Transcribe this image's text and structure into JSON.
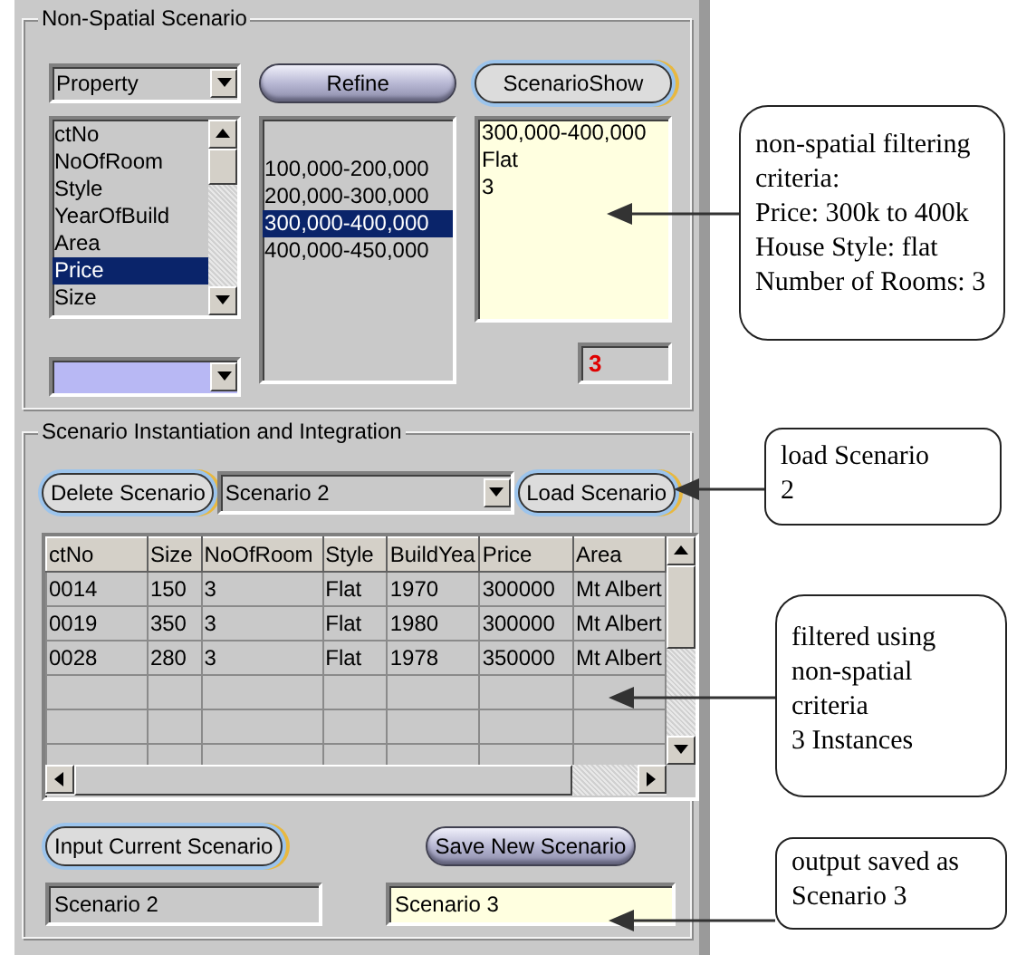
{
  "non_spatial_scenario": {
    "title": "Non-Spatial Scenario",
    "property_dropdown": {
      "value": "Property"
    },
    "refine_button": {
      "label": "Refine",
      "kind": "glossy"
    },
    "scenario_show_button": {
      "label": "ScenarioShow",
      "kind": "ring"
    },
    "fields_list": {
      "items": [
        {
          "label": "ctNo",
          "selected": false
        },
        {
          "label": "NoOfRoom",
          "selected": false
        },
        {
          "label": "Style",
          "selected": false
        },
        {
          "label": "YearOfBuild",
          "selected": false
        },
        {
          "label": "Area",
          "selected": false
        },
        {
          "label": "Price",
          "selected": true
        },
        {
          "label": "Size",
          "selected": false
        }
      ]
    },
    "ranges_list": {
      "items": [
        {
          "label": "100,000-200,000",
          "selected": false
        },
        {
          "label": "200,000-300,000",
          "selected": false
        },
        {
          "label": "300,000-400,000",
          "selected": true
        },
        {
          "label": "400,000-450,000",
          "selected": false
        }
      ]
    },
    "scenario_show": {
      "lines": [
        "300,000-400,000",
        "Flat",
        "3"
      ]
    },
    "count": "3"
  },
  "instantiation": {
    "title": "Scenario Instantiation and Integration",
    "delete_button": {
      "label": "Delete Scenario",
      "kind": "ring"
    },
    "scenario_dropdown": {
      "value": "Scenario 2"
    },
    "load_button": {
      "label": "Load Scenario",
      "kind": "ring"
    },
    "table": {
      "columns": [
        "ctNo",
        "Size",
        "NoOfRoom",
        "Style",
        "BuildYea",
        "Price",
        "Area"
      ],
      "rows": [
        [
          "0014",
          "150",
          "3",
          "Flat",
          "1970",
          "300000",
          "Mt Albert"
        ],
        [
          "0019",
          "350",
          "3",
          "Flat",
          "1980",
          "300000",
          "Mt Albert"
        ],
        [
          "0028",
          "280",
          "3",
          "Flat",
          "1978",
          "350000",
          "Mt Albert"
        ]
      ]
    },
    "input_current_button": {
      "label": "Input Current Scenario",
      "kind": "ring"
    },
    "save_new_button": {
      "label": "Save New Scenario",
      "kind": "glossy"
    },
    "current_field": {
      "value": "Scenario 2"
    },
    "new_field": {
      "value": "Scenario 3"
    }
  },
  "callouts": [
    {
      "lines": [
        "non-spatial filtering",
        "criteria:",
        "Price: 300k to 400k",
        "House Style: flat",
        "Number of Rooms: 3"
      ]
    },
    {
      "lines": [
        "load Scenario",
        "2"
      ]
    },
    {
      "lines": [
        "filtered using",
        "non-spatial",
        "criteria",
        "3 Instances"
      ]
    },
    {
      "lines": [
        "output saved as",
        "Scenario 3"
      ]
    }
  ]
}
